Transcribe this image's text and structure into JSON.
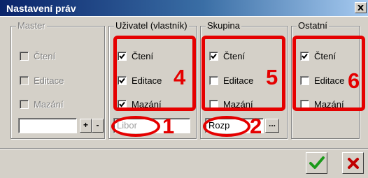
{
  "window": {
    "title": "Nastavení práv",
    "close_icon": "close-icon"
  },
  "groups": {
    "master": {
      "legend": "Master",
      "read": "Čtení",
      "edit": "Editace",
      "delete": "Mazání",
      "field_value": "",
      "plus": "+",
      "minus": "-"
    },
    "user": {
      "legend": "Uživatel (vlastník)",
      "read": "Čtení",
      "edit": "Editace",
      "delete": "Mazání",
      "field_value": "Libor",
      "read_checked": true,
      "edit_checked": true,
      "delete_checked": true
    },
    "group": {
      "legend": "Skupina",
      "read": "Čtení",
      "edit": "Editace",
      "delete": "Mazání",
      "field_value": "Rozp",
      "browse": "...",
      "read_checked": true,
      "edit_checked": false,
      "delete_checked": false
    },
    "others": {
      "legend": "Ostatní",
      "read": "Čtení",
      "edit": "Editace",
      "delete": "Mazání",
      "read_checked": true,
      "edit_checked": false,
      "delete_checked": false
    }
  },
  "annotations": {
    "n1": "1",
    "n2": "2",
    "n4": "4",
    "n5": "5",
    "n6": "6",
    "color": "#e50000"
  },
  "buttons": {
    "ok_icon": "checkmark-icon",
    "cancel_icon": "x-icon"
  },
  "colors": {
    "title_bar": "#0a246a",
    "face": "#d4d0c8",
    "ok": "#1a9a1a",
    "cancel": "#c00000"
  }
}
